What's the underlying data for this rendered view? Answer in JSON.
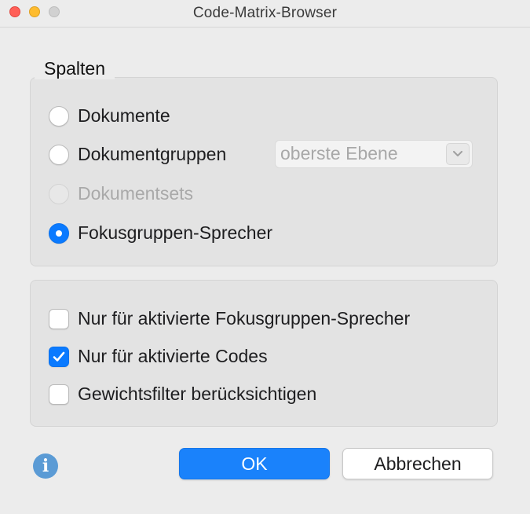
{
  "window": {
    "title": "Code-Matrix-Browser"
  },
  "spalten": {
    "label": "Spalten",
    "options": [
      {
        "label": "Dokumente",
        "selected": false,
        "disabled": false
      },
      {
        "label": "Dokumentgruppen",
        "selected": false,
        "disabled": false
      },
      {
        "label": "Dokumentsets",
        "selected": false,
        "disabled": true
      },
      {
        "label": "Fokusgruppen-Sprecher",
        "selected": true,
        "disabled": false
      }
    ],
    "level_popup": {
      "value": "oberste Ebene",
      "disabled": true
    }
  },
  "filters": [
    {
      "label": "Nur für aktivierte Fokusgruppen-Sprecher",
      "checked": false
    },
    {
      "label": "Nur für aktivierte Codes",
      "checked": true
    },
    {
      "label": "Gewichtsfilter berücksichtigen",
      "checked": false
    }
  ],
  "footer": {
    "info_icon": "info-icon",
    "ok_label": "OK",
    "cancel_label": "Abbrechen"
  },
  "colors": {
    "accent": "#0a7aff",
    "background": "#ececec",
    "group_box": "#e3e3e3"
  }
}
